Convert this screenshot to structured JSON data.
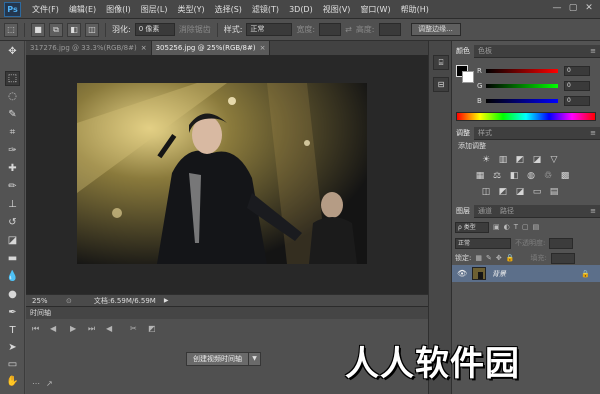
{
  "app": {
    "logo": "Ps"
  },
  "menu": [
    "文件(F)",
    "编辑(E)",
    "图像(I)",
    "图层(L)",
    "类型(Y)",
    "选择(S)",
    "滤镜(T)",
    "3D(D)",
    "视图(V)",
    "窗口(W)",
    "帮助(H)"
  ],
  "window_controls": [
    "—",
    "▢",
    "✕"
  ],
  "options": {
    "feather_label": "羽化:",
    "feather_value": "0 像素",
    "antialias_label": "消除锯齿",
    "style_label": "样式:",
    "style_value": "正常",
    "width_label": "宽度:",
    "height_label": "高度:",
    "refine_edge": "调整边缘..."
  },
  "tabs": [
    {
      "title": "317276.jpg @ 33.3%(RGB/8#)",
      "close": "×"
    },
    {
      "title": "305256.jpg @ 25%(RGB/8#)",
      "close": "×"
    }
  ],
  "status": {
    "zoom": "25%",
    "doc_info": "文档:6.59M/6.59M"
  },
  "timeline": {
    "title": "时间轴",
    "create_button": "创建视频时间轴"
  },
  "color_panel": {
    "tabs": [
      "颜色",
      "色板"
    ],
    "channels": [
      {
        "letter": "R",
        "value": "0"
      },
      {
        "letter": "G",
        "value": "0"
      },
      {
        "letter": "B",
        "value": "0"
      }
    ]
  },
  "adjust_panel": {
    "tabs": [
      "调整",
      "样式"
    ],
    "heading": "添加调整"
  },
  "layers_panel": {
    "tabs": [
      "图层",
      "通道",
      "路径"
    ],
    "filter_kind": "ρ 类型",
    "blend_mode": "正常",
    "opacity_label": "不透明度:",
    "lock_label": "锁定:",
    "fill_label": "填充:",
    "layer_name": "背景"
  },
  "watermark": "人人软件园",
  "colors": {
    "accent": "#5c6f8a",
    "menubar": "#474747",
    "canvas": "#282828"
  }
}
